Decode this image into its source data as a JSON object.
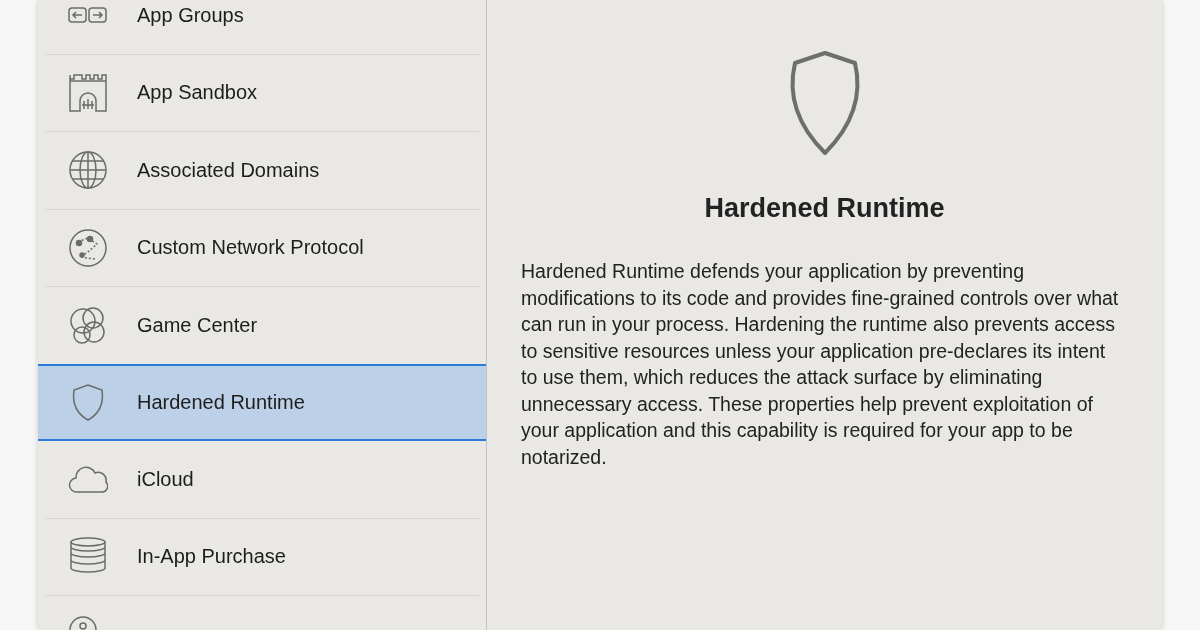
{
  "sidebar": {
    "items": [
      {
        "label": "App Groups",
        "kind": "groups",
        "selected": false
      },
      {
        "label": "App Sandbox",
        "kind": "sandbox",
        "selected": false
      },
      {
        "label": "Associated Domains",
        "kind": "globe",
        "selected": false
      },
      {
        "label": "Custom Network Protocol",
        "kind": "network",
        "selected": false
      },
      {
        "label": "Game Center",
        "kind": "circles",
        "selected": false
      },
      {
        "label": "Hardened Runtime",
        "kind": "shield",
        "selected": true
      },
      {
        "label": "iCloud",
        "kind": "cloud",
        "selected": false
      },
      {
        "label": "In-App Purchase",
        "kind": "coins",
        "selected": false
      },
      {
        "kind": "keychain",
        "selected": false
      }
    ]
  },
  "detail": {
    "title": "Hardened Runtime",
    "description": "Hardened Runtime defends your application by preventing modifications to its code and provides fine-grained controls over what can run in your process. Hardening the runtime also prevents access to sensitive resources unless your application pre-declares its intent to use them, which reduces the attack surface by eliminating unnecessary access. These properties help prevent exploitation of your application and this capability is required for your app to be notarized."
  }
}
